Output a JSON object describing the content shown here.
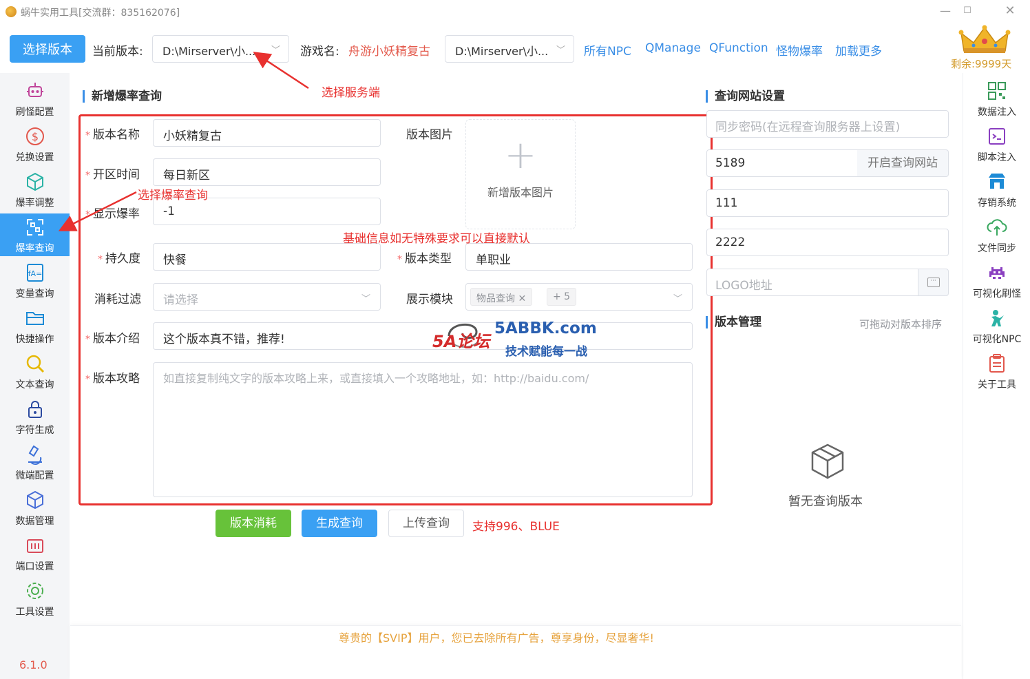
{
  "window": {
    "title": "蜗牛实用工具[交流群：835162076]"
  },
  "toolbar": {
    "select_version_label": "选择版本",
    "current_version_label": "当前版本:",
    "current_version_value": "D:\\Mirserver\\小...",
    "game_name_label": "游戏名:",
    "game_name_value": "舟游小妖精复古",
    "server_select_value": "D:\\Mirserver\\小...",
    "links": [
      "所有NPC",
      "QManage",
      "QFunction",
      "怪物爆率",
      "加载更多"
    ],
    "remaining": "剩余:9999天"
  },
  "sidebar_left": {
    "items": [
      {
        "label": "刷怪配置",
        "icon": "robot-icon"
      },
      {
        "label": "兑换设置",
        "icon": "dollar-icon"
      },
      {
        "label": "爆率调整",
        "icon": "cube-icon"
      },
      {
        "label": "爆率查询",
        "icon": "scan-icon",
        "active": true
      },
      {
        "label": "变量查询",
        "icon": "formula-icon"
      },
      {
        "label": "快捷操作",
        "icon": "folder-icon"
      },
      {
        "label": "文本查询",
        "icon": "search-icon"
      },
      {
        "label": "字符生成",
        "icon": "lock-icon"
      },
      {
        "label": "微端配置",
        "icon": "microscope-icon"
      },
      {
        "label": "数据管理",
        "icon": "box-icon"
      },
      {
        "label": "端口设置",
        "icon": "port-icon"
      },
      {
        "label": "工具设置",
        "icon": "gear-icon"
      }
    ],
    "version": "6.1.0"
  },
  "sidebar_right": {
    "items": [
      {
        "label": "数据注入",
        "icon": "qrcode-icon"
      },
      {
        "label": "脚本注入",
        "icon": "terminal-icon"
      },
      {
        "label": "存销系统",
        "icon": "store-icon"
      },
      {
        "label": "文件同步",
        "icon": "cloud-sync-icon"
      },
      {
        "label": "可视化刷怪",
        "icon": "invader-icon"
      },
      {
        "label": "可视化NPC",
        "icon": "person-icon"
      },
      {
        "label": "关于工具",
        "icon": "clipboard-icon"
      }
    ]
  },
  "form": {
    "section_title": "新增爆率查询",
    "version_name": {
      "label": "版本名称",
      "value": "小妖精复古"
    },
    "version_image": {
      "label": "版本图片",
      "upload_text": "新增版本图片"
    },
    "open_time": {
      "label": "开区时间",
      "value": "每日新区"
    },
    "display_rate": {
      "label": "显示爆率",
      "value": "-1"
    },
    "durability": {
      "label": "持久度",
      "value": "快餐"
    },
    "version_type": {
      "label": "版本类型",
      "value": "单职业"
    },
    "consume_filter": {
      "label": "消耗过滤",
      "placeholder": "请选择"
    },
    "display_module": {
      "label": "展示模块",
      "tag": "物品查询",
      "more": "+ 5"
    },
    "intro": {
      "label": "版本介绍",
      "value": "这个版本真不错，推荐!"
    },
    "guide": {
      "label": "版本攻略",
      "placeholder": "如直接复制纯文字的版本攻略上来，或直接填入一个攻略地址，如：http://baidu.com/"
    }
  },
  "buttons": {
    "consume": "版本消耗",
    "generate": "生成查询",
    "upload": "上传查询",
    "support": "支持996、BLUE"
  },
  "annotations": {
    "select_server": "选择服务端",
    "select_query": "选择爆率查询",
    "default_info": "基础信息如无特殊要求可以直接默认"
  },
  "site_settings": {
    "section_title": "查询网站设置",
    "sync_password_placeholder": "同步密码(在远程查询服务器上设置)",
    "port_value": "5189",
    "open_site_label": "开启查询网站",
    "field2_value": "111",
    "field3_value": "2222",
    "logo_placeholder": "LOGO地址"
  },
  "version_manage": {
    "section_title": "版本管理",
    "drag_hint": "可拖动对版本排序",
    "empty_text": "暂无查询版本"
  },
  "footer": {
    "text": "尊贵的【SVIP】用户，您已去除所有广告，尊享身份，尽显奢华!"
  },
  "watermark": {
    "brand": "5A论坛",
    "site": "5ABBK.com",
    "slogan": "技术赋能每一战"
  },
  "colors": {
    "accent": "#3aa0f3",
    "success": "#67c23a",
    "annotation": "#e8312f",
    "link": "#3a8ee6",
    "footer": "#e6a23c"
  }
}
